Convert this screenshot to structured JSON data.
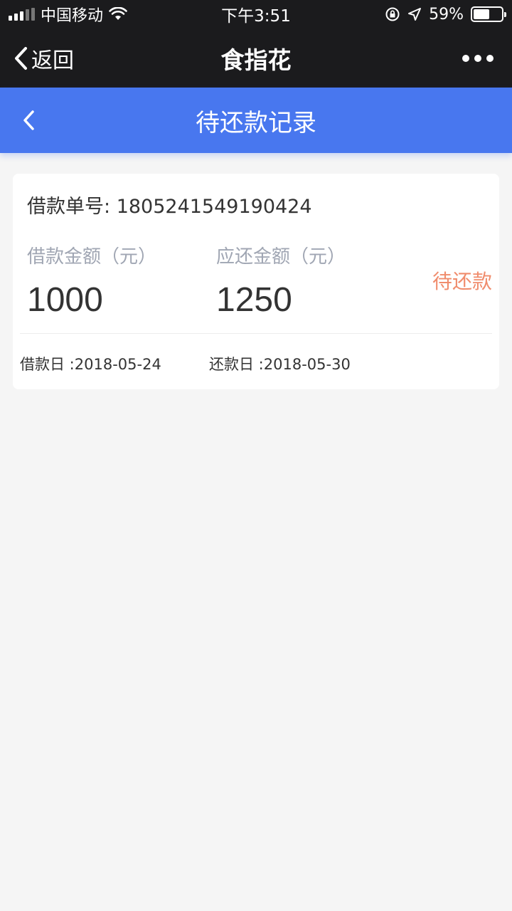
{
  "status_bar": {
    "carrier": "中国移动",
    "time": "下午3:51",
    "battery": "59%",
    "battery_level": 0.59
  },
  "nav": {
    "back_label": "返回",
    "title": "食指花"
  },
  "page": {
    "title": "待还款记录"
  },
  "record": {
    "loan_no_label": "借款单号: ",
    "loan_no": "1805241549190424",
    "loan_amount_label": "借款金额（元）",
    "loan_amount": "1000",
    "repay_amount_label": "应还金额（元）",
    "repay_amount": "1250",
    "status": "待还款",
    "loan_date_label": "借款日 :",
    "loan_date": "2018-05-24",
    "repay_date_label": "还款日 :",
    "repay_date": "2018-05-30"
  },
  "colors": {
    "nav_bg": "#1b1b1d",
    "header_bg": "#4877ef",
    "status": "#f08c6c",
    "label": "#a0a6b3"
  },
  "icons": [
    "signal-icon",
    "wifi-icon",
    "orientation-lock-icon",
    "location-icon",
    "battery-icon",
    "chevron-left-icon",
    "more-icon"
  ]
}
